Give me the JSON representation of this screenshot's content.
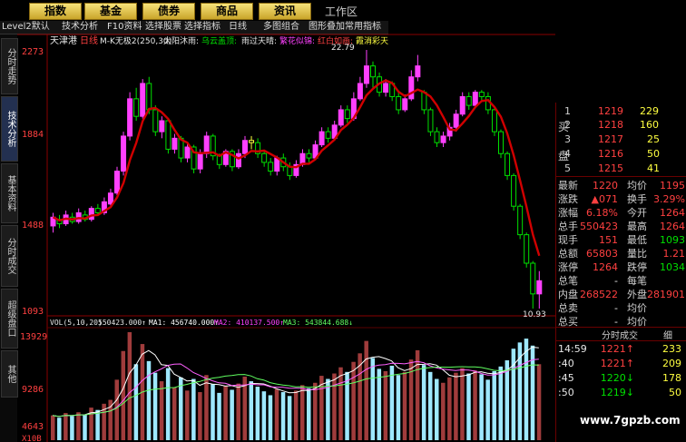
{
  "top_tabs": [
    "指数",
    "基金",
    "债券",
    "商品",
    "资讯"
  ],
  "work_area": "工作区",
  "toolbar": [
    "Level2默认",
    "技术分析",
    "F10资料",
    "选择股票",
    "选择指标",
    "日线",
    "多图组合",
    "图形叠加",
    "常用指标"
  ],
  "side_tabs": [
    "分时走势",
    "技术分析",
    "基本资料",
    "分时成交",
    "超级盘口",
    "其他"
  ],
  "stock_name": "天津港",
  "period": "日线",
  "indicator_line": "M-K无极2(250,30)",
  "pattern_labels": [
    "太阳沐雨:",
    "乌云盖顶:",
    "雨过天晴:",
    "繁花似锦:",
    "红白如画:",
    "霞消彩天"
  ],
  "price_axis": [
    "2273",
    "1884",
    "1488",
    "1093"
  ],
  "high_marker": "22.79",
  "low_marker": "10.93",
  "vol_header": {
    "vol": "VOL(5,10,20)",
    "v": "550423.000↑",
    "ma1": "MA1: 456740.000↑",
    "ma2": "MA2: 410137.500↑",
    "ma3": "MA3: 543844.688↓"
  },
  "vol_axis": [
    "13929",
    "9286",
    "4643",
    "X10B"
  ],
  "order_book": {
    "side_labels": [
      "买",
      "盘"
    ],
    "rows": [
      {
        "level": "1",
        "price": "1219",
        "vol": "229"
      },
      {
        "level": "2",
        "price": "1218",
        "vol": "160"
      },
      {
        "level": "3",
        "price": "1217",
        "vol": "25"
      },
      {
        "level": "4",
        "price": "1216",
        "vol": "50"
      },
      {
        "level": "5",
        "price": "1215",
        "vol": "41"
      }
    ]
  },
  "quote": [
    {
      "l1": "最新",
      "v1": "1220",
      "l2": "均价",
      "v2": "1195"
    },
    {
      "l1": "涨跌",
      "v1": "▲071",
      "l2": "换手",
      "v2": "3.29%"
    },
    {
      "l1": "涨幅",
      "v1": "6.18%",
      "l2": "今开",
      "v2": "1264"
    },
    {
      "l1": "总手",
      "v1": "550423",
      "l2": "最高",
      "v2": "1264"
    },
    {
      "l1": "现手",
      "v1": "151",
      "l2": "最低",
      "v2": "1093"
    },
    {
      "l1": "总额",
      "v1": "65803",
      "l2": "量比",
      "v2": "1.21"
    },
    {
      "l1": "涨停",
      "v1": "1264",
      "l2": "跌停",
      "v2": "1034"
    },
    {
      "l1": "总笔",
      "v1": "-",
      "l2": "每笔",
      "v2": ""
    },
    {
      "l1": "内盘",
      "v1": "268522",
      "l2": "外盘",
      "v2": "281901"
    },
    {
      "l1": "总卖",
      "v1": "-",
      "l2": "均价",
      "v2": ""
    },
    {
      "l1": "总买",
      "v1": "-",
      "l2": "均价",
      "v2": ""
    }
  ],
  "ticks_header": {
    "title": "分时成交",
    "detail": "细"
  },
  "ticks": [
    {
      "time": "14:59",
      "price": "1221↑",
      "vol": "233"
    },
    {
      "time": ":40",
      "price": "1221↑",
      "vol": "209"
    },
    {
      "time": ":45",
      "price": "1220↓",
      "vol": "178"
    },
    {
      "time": ":50",
      "price": "1219↓",
      "vol": "50"
    }
  ],
  "watermark": "www.7gpzb.com",
  "colors": {
    "up": "#ff40ff",
    "down": "#00e000",
    "doji": "#ffff40",
    "ma": "#d00000",
    "volup": "#a03c3c",
    "voldown": "#9ee8ff"
  },
  "chart_data": {
    "type": "candlestick",
    "ylim": [
      1093,
      2273
    ],
    "candles": [
      [
        1470,
        1510,
        1440,
        1530
      ],
      [
        1500,
        1480,
        1460,
        1520
      ],
      [
        1480,
        1520,
        1470,
        1540
      ],
      [
        1510,
        1490,
        1480,
        1530
      ],
      [
        1490,
        1530,
        1480,
        1550
      ],
      [
        1520,
        1500,
        1490,
        1540
      ],
      [
        1500,
        1550,
        1490,
        1560
      ],
      [
        1550,
        1530,
        1520,
        1570
      ],
      [
        1530,
        1580,
        1520,
        1600
      ],
      [
        1570,
        1620,
        1560,
        1640
      ],
      [
        1620,
        1720,
        1610,
        1740
      ],
      [
        1720,
        1880,
        1700,
        1900
      ],
      [
        1880,
        2050,
        1860,
        2080
      ],
      [
        2050,
        1970,
        1950,
        2100
      ],
      [
        1970,
        2120,
        1960,
        2140
      ],
      [
        2120,
        2000,
        1980,
        2150
      ],
      [
        2000,
        1900,
        1880,
        2020
      ],
      [
        1900,
        1950,
        1870,
        1970
      ],
      [
        1950,
        1820,
        1800,
        1960
      ],
      [
        1820,
        1870,
        1800,
        1890
      ],
      [
        1870,
        1780,
        1760,
        1880
      ],
      [
        1780,
        1830,
        1760,
        1850
      ],
      [
        1830,
        1730,
        1710,
        1840
      ],
      [
        1730,
        1800,
        1710,
        1820
      ],
      [
        1800,
        1880,
        1780,
        1900
      ],
      [
        1880,
        1790,
        1770,
        1890
      ],
      [
        1790,
        1750,
        1730,
        1800
      ],
      [
        1750,
        1810,
        1740,
        1820
      ],
      [
        1810,
        1740,
        1720,
        1820
      ],
      [
        1740,
        1800,
        1730,
        1820
      ],
      [
        1800,
        1860,
        1780,
        1880
      ],
      [
        1860,
        1850,
        1820,
        1880
      ],
      [
        1850,
        1800,
        1780,
        1870
      ],
      [
        1800,
        1760,
        1740,
        1810
      ],
      [
        1760,
        1720,
        1700,
        1780
      ],
      [
        1720,
        1780,
        1700,
        1790
      ],
      [
        1780,
        1740,
        1720,
        1800
      ],
      [
        1740,
        1700,
        1680,
        1760
      ],
      [
        1700,
        1750,
        1690,
        1770
      ],
      [
        1750,
        1800,
        1740,
        1820
      ],
      [
        1800,
        1780,
        1760,
        1820
      ],
      [
        1780,
        1840,
        1770,
        1860
      ],
      [
        1840,
        1900,
        1830,
        1920
      ],
      [
        1900,
        1870,
        1850,
        1920
      ],
      [
        1870,
        1930,
        1860,
        1950
      ],
      [
        1930,
        2000,
        1920,
        2020
      ],
      [
        2000,
        1960,
        1940,
        2020
      ],
      [
        1960,
        2050,
        1950,
        2080
      ],
      [
        2050,
        2120,
        2040,
        2150
      ],
      [
        2120,
        2200,
        2100,
        2273
      ],
      [
        2200,
        2150,
        2100,
        2220
      ],
      [
        2150,
        2080,
        2060,
        2170
      ],
      [
        2080,
        2120,
        2060,
        2140
      ],
      [
        2120,
        2060,
        2040,
        2130
      ],
      [
        2060,
        2000,
        1980,
        2080
      ],
      [
        2000,
        2050,
        1990,
        2070
      ],
      [
        2050,
        2150,
        2040,
        2180
      ],
      [
        2150,
        2200,
        2130,
        2250
      ],
      [
        2080,
        2000,
        1980,
        2090
      ],
      [
        2000,
        1900,
        1880,
        2010
      ],
      [
        1900,
        1850,
        1830,
        1920
      ],
      [
        1850,
        1880,
        1830,
        1900
      ],
      [
        1880,
        1920,
        1860,
        1940
      ],
      [
        1920,
        1980,
        1900,
        2000
      ],
      [
        1980,
        2060,
        1970,
        2080
      ],
      [
        2060,
        2020,
        2000,
        2080
      ],
      [
        2020,
        2080,
        2010,
        2090
      ],
      [
        2080,
        2060,
        2040,
        2090
      ],
      [
        2060,
        2000,
        1980,
        2080
      ],
      [
        2000,
        1900,
        1880,
        2010
      ],
      [
        1900,
        1800,
        1780,
        1910
      ],
      [
        1800,
        1700,
        1680,
        1810
      ],
      [
        1700,
        1560,
        1540,
        1710
      ],
      [
        1560,
        1430,
        1410,
        1570
      ],
      [
        1430,
        1300,
        1280,
        1440
      ],
      [
        1300,
        1160,
        1093,
        1310
      ],
      [
        1160,
        1220,
        1093,
        1264
      ]
    ],
    "volumes": [
      3200,
      2900,
      3500,
      3100,
      3600,
      3300,
      4200,
      3900,
      4700,
      5200,
      7800,
      11500,
      13929,
      9800,
      12400,
      10200,
      8700,
      7600,
      9300,
      6800,
      8100,
      6400,
      7900,
      6200,
      8400,
      7200,
      6100,
      7000,
      6500,
      7300,
      8200,
      7600,
      6900,
      6300,
      5800,
      6600,
      6200,
      5700,
      6400,
      7100,
      6700,
      7400,
      8300,
      7900,
      8600,
      9400,
      8800,
      10100,
      11200,
      12800,
      10600,
      9200,
      8900,
      9600,
      8400,
      8800,
      10400,
      11600,
      9700,
      8800,
      7900,
      7400,
      8100,
      8700,
      9300,
      8600,
      9000,
      8500,
      7800,
      8900,
      9500,
      10300,
      11800,
      12600,
      13100,
      12200,
      9800
    ]
  }
}
